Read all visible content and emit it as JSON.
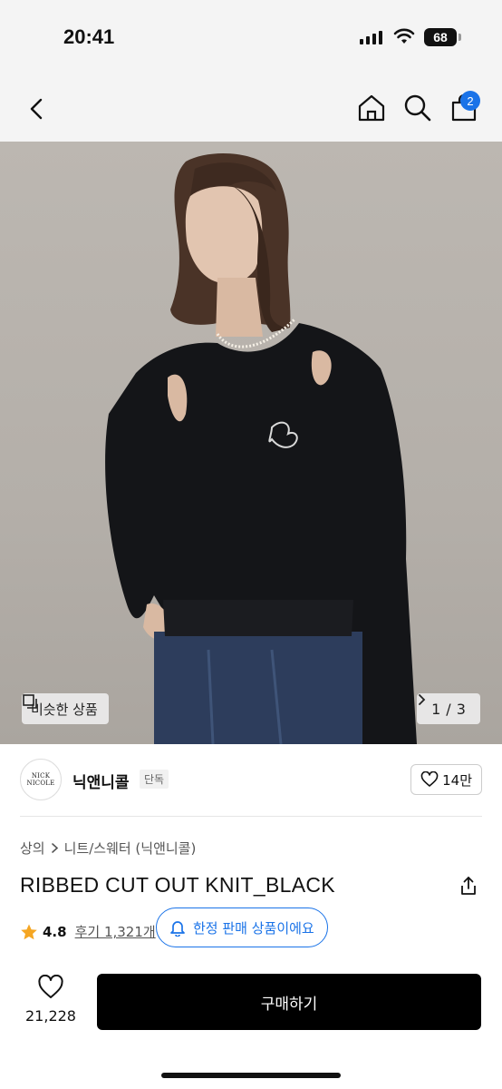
{
  "status_bar": {
    "time": "20:41",
    "battery": "68"
  },
  "nav": {
    "cart_count": "2"
  },
  "gallery": {
    "similar_label": "비슷한 상품",
    "page_current": "1",
    "page_total": "3",
    "page_separator": "/"
  },
  "brand": {
    "logo_line1": "NICK",
    "logo_line2": "NICOLE",
    "name": "닉앤니콜",
    "tag": "단독",
    "likes": "14만"
  },
  "breadcrumb": [
    "상의",
    "니트/스웨터 (닉앤니콜)"
  ],
  "product": {
    "title": "RIBBED CUT OUT KNIT_BLACK",
    "rating": "4.8",
    "reviews": "후기 1,321개"
  },
  "notice": {
    "limited": "한정 판매 상품이에요"
  },
  "bottom_bar": {
    "like_count": "21,228",
    "buy_label": "구매하기"
  },
  "colors": {
    "accent": "#1a73e8",
    "buy_button": "#000000",
    "star": "#f5a623"
  },
  "icons": [
    "back-icon",
    "home-icon",
    "search-icon",
    "cart-icon",
    "similar-icon",
    "chevron-right-icon",
    "heart-icon",
    "share-icon",
    "star-icon",
    "bell-icon"
  ]
}
